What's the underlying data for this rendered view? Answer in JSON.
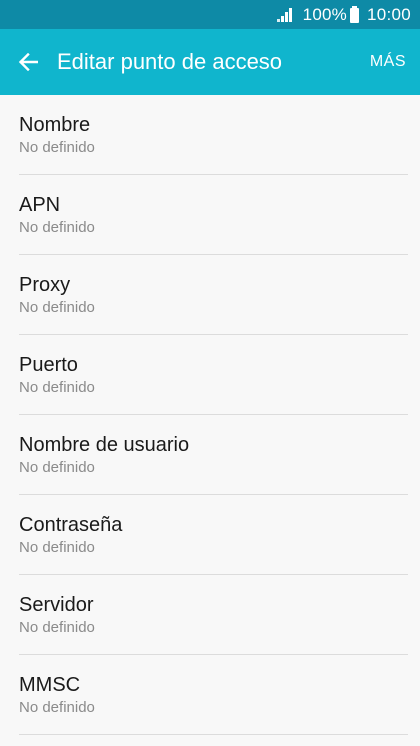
{
  "status_bar": {
    "battery_percent": "100%",
    "time": "10:00",
    "icons": [
      "signal-icon",
      "battery-icon"
    ]
  },
  "app_bar": {
    "title": "Editar punto de acceso",
    "more_label": "MÁS",
    "back_icon": "back-arrow-icon"
  },
  "colors": {
    "status_bar": "#0e8aa6",
    "app_bar": "#10b5cd",
    "background": "#f8f8f8"
  },
  "settings": [
    {
      "title": "Nombre",
      "summary": "No definido"
    },
    {
      "title": "APN",
      "summary": "No definido"
    },
    {
      "title": "Proxy",
      "summary": "No definido"
    },
    {
      "title": "Puerto",
      "summary": "No definido"
    },
    {
      "title": "Nombre de usuario",
      "summary": "No definido"
    },
    {
      "title": "Contraseña",
      "summary": "No definido"
    },
    {
      "title": "Servidor",
      "summary": "No definido"
    },
    {
      "title": "MMSC",
      "summary": "No definido"
    }
  ]
}
